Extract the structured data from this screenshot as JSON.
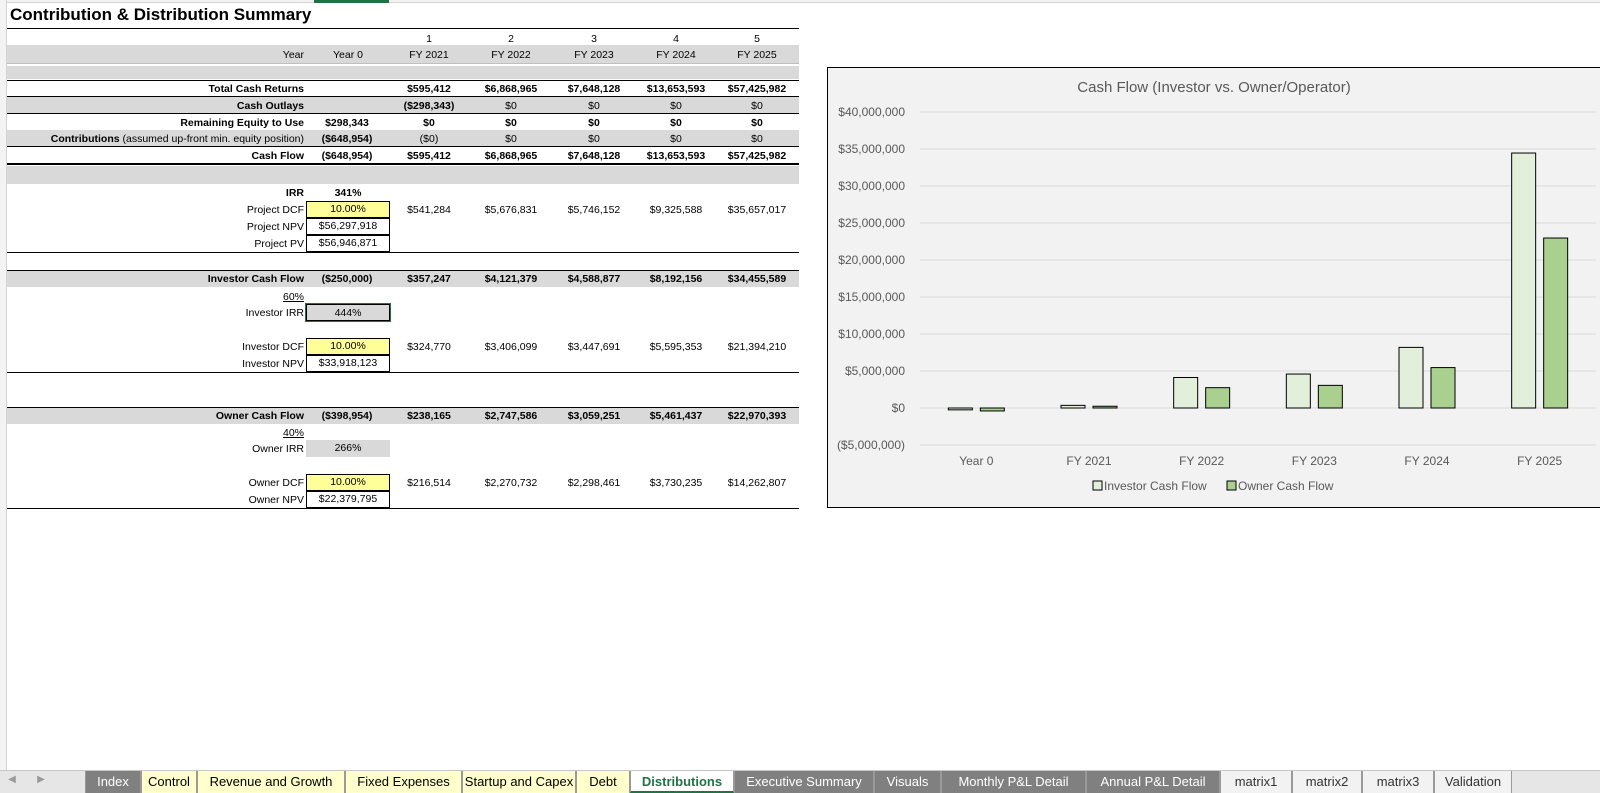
{
  "sheet": {
    "title": "Contribution & Distribution Summary",
    "period_numbers": [
      "1",
      "2",
      "3",
      "4",
      "5"
    ],
    "year_label": "Year",
    "columns": [
      "Year 0",
      "FY 2021",
      "FY 2022",
      "FY 2023",
      "FY 2024",
      "FY 2025"
    ]
  },
  "summary_rows": [
    {
      "label": "Total Cash Returns",
      "label_extra": "",
      "values": [
        "",
        "$595,412",
        "$6,868,965",
        "$7,648,128",
        "$13,653,593",
        "$57,425,982"
      ]
    },
    {
      "label": "Cash Outlays",
      "label_extra": "",
      "values": [
        "",
        "($298,343)",
        "$0",
        "$0",
        "$0",
        "$0"
      ]
    },
    {
      "label": "Remaining Equity to Use",
      "label_extra": "",
      "values": [
        "$298,343",
        "$0",
        "$0",
        "$0",
        "$0",
        "$0"
      ]
    },
    {
      "label": "Contributions",
      "label_extra": " (assumed up-front min. equity position)",
      "values": [
        "($648,954)",
        "($0)",
        "$0",
        "$0",
        "$0",
        "$0"
      ]
    },
    {
      "label": "Cash Flow",
      "label_extra": "",
      "values": [
        "($648,954)",
        "$595,412",
        "$6,868,965",
        "$7,648,128",
        "$13,653,593",
        "$57,425,982"
      ]
    }
  ],
  "project": {
    "irr_label": "IRR",
    "irr_value": "341%",
    "dcf_label": "Project DCF",
    "dcf_value": "10.00%",
    "dcf_row": [
      "$541,284",
      "$5,676,831",
      "$5,746,152",
      "$9,325,588",
      "$35,657,017"
    ],
    "npv_label": "Project NPV",
    "npv_value": "$56,297,918",
    "pv_label": "Project PV",
    "pv_value": "$56,946,871"
  },
  "investor": {
    "cf_label": "Investor Cash Flow",
    "cf_values": [
      "($250,000)",
      "$357,247",
      "$4,121,379",
      "$4,588,877",
      "$8,192,156",
      "$34,455,589"
    ],
    "share": "60%",
    "irr_label": "Investor IRR",
    "irr_value": "444%",
    "dcf_label": "Investor DCF",
    "dcf_value": "10.00%",
    "dcf_row": [
      "$324,770",
      "$3,406,099",
      "$3,447,691",
      "$5,595,353",
      "$21,394,210"
    ],
    "npv_label": "Investor NPV",
    "npv_value": "$33,918,123"
  },
  "owner": {
    "cf_label": "Owner Cash Flow",
    "cf_values": [
      "($398,954)",
      "$238,165",
      "$2,747,586",
      "$3,059,251",
      "$5,461,437",
      "$22,970,393"
    ],
    "share": "40%",
    "irr_label": "Owner IRR",
    "irr_value": "266%",
    "dcf_label": "Owner DCF",
    "dcf_value": "10.00%",
    "dcf_row": [
      "$216,514",
      "$2,270,732",
      "$2,298,461",
      "$3,730,235",
      "$14,262,807"
    ],
    "npv_label": "Owner NPV",
    "npv_value": "$22,379,795"
  },
  "chart_data": {
    "type": "bar",
    "title": "Cash Flow (Investor vs. Owner/Operator)",
    "categories": [
      "Year 0",
      "FY 2021",
      "FY 2022",
      "FY 2023",
      "FY 2024",
      "FY 2025"
    ],
    "series": [
      {
        "name": "Investor Cash Flow",
        "values": [
          -250000,
          357247,
          4121379,
          4588877,
          8192156,
          34455589
        ],
        "color": "#e2efda"
      },
      {
        "name": "Owner Cash Flow",
        "values": [
          -398954,
          238165,
          2747586,
          3059251,
          5461437,
          22970393
        ],
        "color": "#a9d08e"
      }
    ],
    "yticks": [
      "$40,000,000",
      "$35,000,000",
      "$30,000,000",
      "$25,000,000",
      "$20,000,000",
      "$15,000,000",
      "$10,000,000",
      "$5,000,000",
      "$0",
      "($5,000,000)"
    ],
    "ylim": [
      -5000000,
      40000000
    ],
    "grid": true,
    "legend_position": "bottom"
  },
  "tabs": [
    {
      "label": "Index",
      "style": "gray"
    },
    {
      "label": "Control",
      "style": "yellow"
    },
    {
      "label": "Revenue and Growth",
      "style": "yellow"
    },
    {
      "label": "Fixed Expenses",
      "style": "yellow"
    },
    {
      "label": "Startup and Capex",
      "style": "yellow"
    },
    {
      "label": "Debt",
      "style": "yellow"
    },
    {
      "label": "Distributions",
      "style": "active"
    },
    {
      "label": "Executive Summary",
      "style": "gray"
    },
    {
      "label": "Visuals",
      "style": "gray"
    },
    {
      "label": "Monthly P&L Detail",
      "style": "gray"
    },
    {
      "label": "Annual P&L Detail",
      "style": "gray"
    },
    {
      "label": "matrix1",
      "style": "plain"
    },
    {
      "label": "matrix2",
      "style": "plain"
    },
    {
      "label": "matrix3",
      "style": "plain"
    },
    {
      "label": "Validation",
      "style": "plain"
    }
  ]
}
